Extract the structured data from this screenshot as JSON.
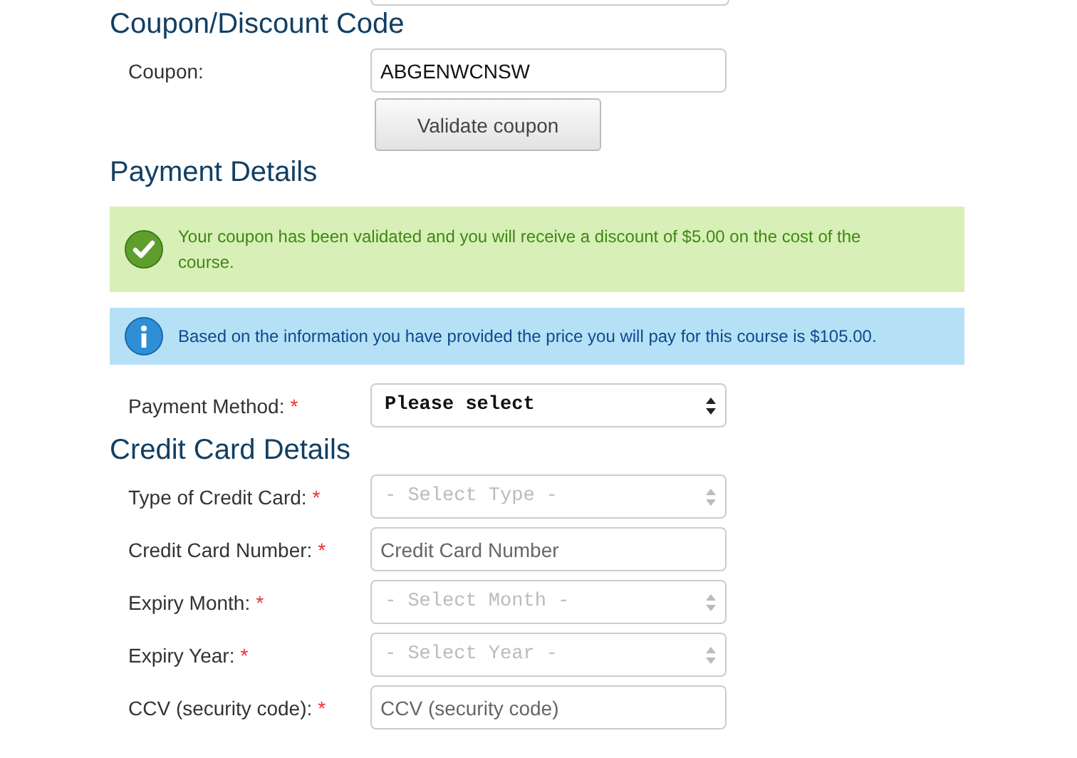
{
  "sections": [
    {
      "heading": "Coupon/Discount Code",
      "fields": [
        {
          "label": "Coupon:",
          "kind": "text",
          "value": "ABGENWCNSW"
        }
      ],
      "button": "Validate coupon"
    },
    {
      "heading": "Payment Details",
      "alerts": [
        {
          "kind": "success",
          "text": "Your coupon has been validated and you will receive a discount of $5.00 on the cost of the course."
        },
        {
          "kind": "info",
          "text": "Based on the information you have provided the price you will pay for this course is $105.00."
        }
      ],
      "fields": [
        {
          "label": "Payment Method:",
          "marker": "*",
          "kind": "select",
          "value": "Please select",
          "disabled": false
        }
      ]
    },
    {
      "heading": "Credit Card Details",
      "fields": [
        {
          "label": "Type of Credit Card:",
          "marker": "*",
          "kind": "select",
          "value": "- Select Type -",
          "disabled": true
        },
        {
          "label": "Credit Card Number:",
          "marker": "*",
          "kind": "text",
          "placeholder": "Credit Card Number"
        },
        {
          "label": "Expiry Month:",
          "marker": "*",
          "kind": "select",
          "value": "- Select Month -",
          "disabled": true
        },
        {
          "label": "Expiry Year:",
          "marker": "*",
          "kind": "select",
          "value": "- Select Year -",
          "disabled": true
        },
        {
          "label": "CCV (security code):",
          "marker": "*",
          "kind": "text",
          "placeholder": "CCV (security code)"
        }
      ]
    }
  ]
}
